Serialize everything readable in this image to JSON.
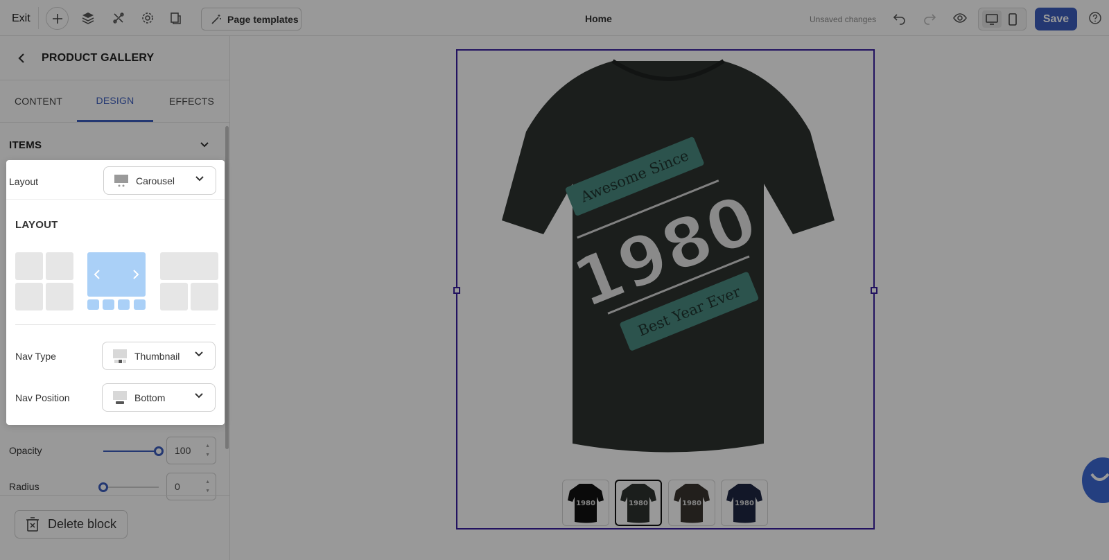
{
  "topbar": {
    "exit_label": "Exit",
    "page_templates_label": "Page templates",
    "page_title": "Home",
    "status": "Unsaved changes",
    "save_label": "Save"
  },
  "panel": {
    "title": "PRODUCT GALLERY",
    "tabs": [
      {
        "label": "CONTENT",
        "active": false
      },
      {
        "label": "DESIGN",
        "active": true
      },
      {
        "label": "EFFECTS",
        "active": false
      }
    ],
    "section_title": "ITEMS",
    "opacity": {
      "label": "Opacity",
      "value": "100",
      "level_percent": 100
    },
    "radius": {
      "label": "Radius",
      "value": "0",
      "level_percent": 0
    },
    "delete_label": "Delete block"
  },
  "popup": {
    "layout_label": "Layout",
    "layout_value": "Carousel",
    "heading": "LAYOUT",
    "options": [
      "grid",
      "carousel",
      "feature-grid"
    ],
    "selected_option": "carousel",
    "nav_type_label": "Nav Type",
    "nav_type_value": "Thumbnail",
    "nav_position_label": "Nav Position",
    "nav_position_value": "Bottom"
  },
  "gallery": {
    "main_shirt_color": "#2d3330",
    "thumbnails": [
      {
        "color": "#111111",
        "active": false
      },
      {
        "color": "#2d3330",
        "active": true
      },
      {
        "color": "#3a3430",
        "active": false
      },
      {
        "color": "#1f2744",
        "active": false
      }
    ],
    "print_top": "Awesome Since",
    "print_year": "1980",
    "print_bottom": "Best Year Ever"
  },
  "colors": {
    "accent": "#3d5ebf",
    "selection_frame": "#3a1fa0",
    "ribbon": "#4a8b80"
  }
}
